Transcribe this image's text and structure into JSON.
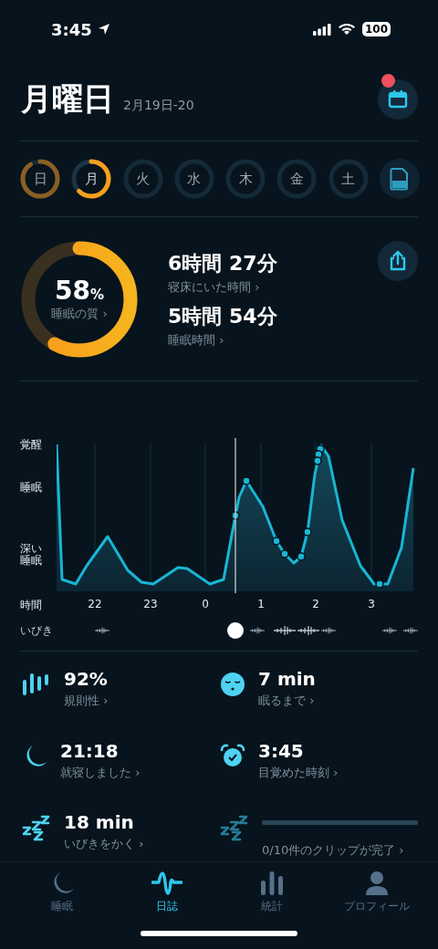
{
  "status_bar": {
    "time": "3:45",
    "battery": "100"
  },
  "header": {
    "title": "月曜日",
    "date": "2月19日-20",
    "calendar_badge": true
  },
  "days": [
    {
      "label": "日",
      "has_data": true,
      "selected": false
    },
    {
      "label": "月",
      "has_data": true,
      "selected": true
    },
    {
      "label": "火",
      "has_data": false,
      "selected": false
    },
    {
      "label": "水",
      "has_data": false,
      "selected": false
    },
    {
      "label": "木",
      "has_data": false,
      "selected": false
    },
    {
      "label": "金",
      "has_data": false,
      "selected": false
    },
    {
      "label": "土",
      "has_data": false,
      "selected": false
    }
  ],
  "quality": {
    "value": "58",
    "unit": "%",
    "label": "睡眠の質 ›"
  },
  "durations": [
    {
      "value": "6時間 27分",
      "label": "寝床にいた時間 ›"
    },
    {
      "value": "5時間 54分",
      "label": "睡眠時間 ›"
    }
  ],
  "chart": {
    "y_labels": [
      "覚醒",
      "睡眠",
      "深い睡眠"
    ],
    "x_title": "時間",
    "x_ticks": [
      "22",
      "23",
      "0",
      "1",
      "2",
      "3"
    ],
    "snore_label": "いびき"
  },
  "metrics": [
    {
      "kind": "regularity",
      "value": "92%",
      "label": "規則性 ›"
    },
    {
      "kind": "fall_asleep",
      "value": "7 min",
      "label": "眠るまで ›"
    },
    {
      "kind": "bedtime",
      "value": "21:18",
      "label": "就寝しました ›"
    },
    {
      "kind": "wakeup",
      "value": "3:45",
      "label": "目覚めた時刻 ›"
    },
    {
      "kind": "snoring",
      "value": "18 min",
      "label": "いびきをかく ›"
    },
    {
      "kind": "clips",
      "label": "0/10件のクリップが完了 ›"
    }
  ],
  "tabs": [
    {
      "label": "睡眠",
      "selected": false
    },
    {
      "label": "日誌",
      "selected": true
    },
    {
      "label": "統計",
      "selected": false
    },
    {
      "label": "プロフィール",
      "selected": false
    }
  ]
}
